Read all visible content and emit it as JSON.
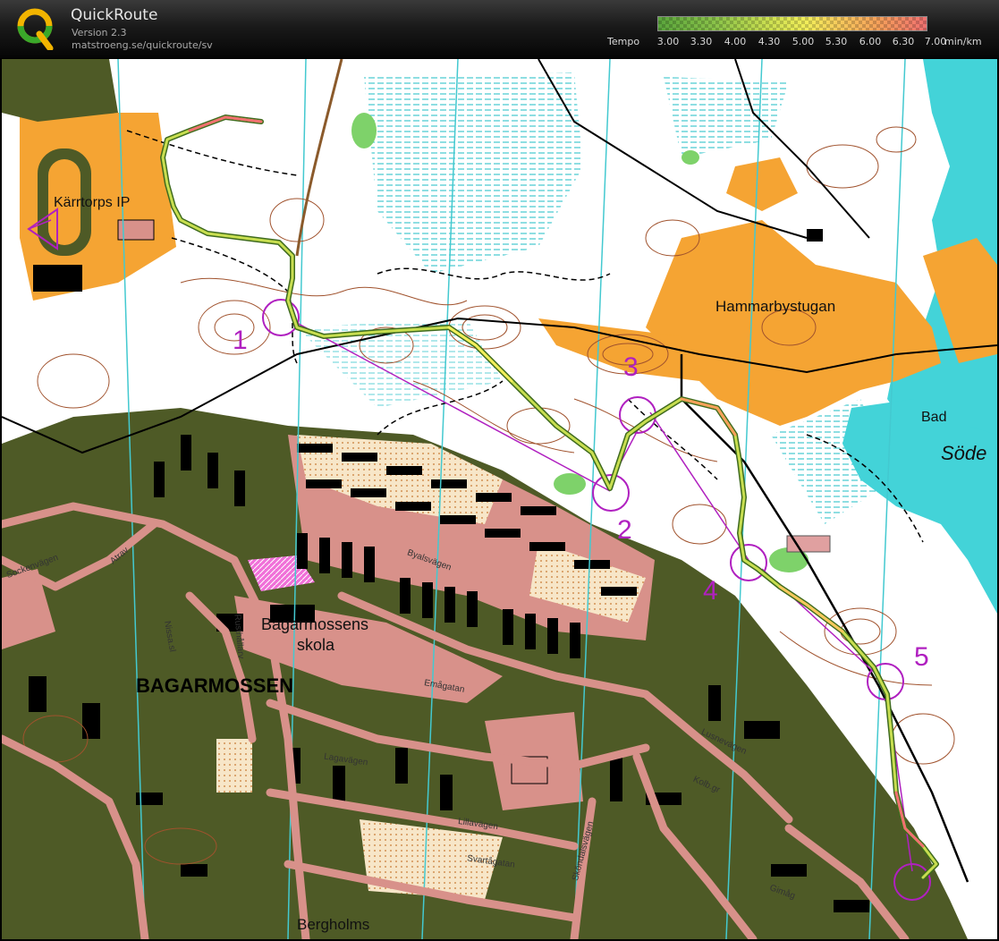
{
  "app": {
    "name": "QuickRoute",
    "version": "Version 2.3",
    "url": "matstroeng.se/quickroute/sv"
  },
  "tempo_legend": {
    "label": "Tempo",
    "ticks": [
      "3.00",
      "3.30",
      "4.00",
      "4.30",
      "5.00",
      "5.30",
      "6.00",
      "6.30",
      "7.00"
    ],
    "unit": "min/km",
    "colors": [
      "#5aa53c",
      "#8cc44a",
      "#c8de50",
      "#f2ee5a",
      "#f6c85c",
      "#f5a05a",
      "#f07070"
    ]
  },
  "map": {
    "place_names": {
      "karrtorp": "Kärrtorps IP",
      "hammarbystugan": "Hammarbystugan",
      "bad": "Bad",
      "sode": "Söde",
      "bagarmossen": "BAGARMOSSEN",
      "bagarmossens": "Bagarmossens",
      "skola": "skola",
      "bergholms": "Bergholms"
    },
    "streets": {
      "sockenvagen": "Sockenvägen",
      "byalsvagen": "Byalsvägen",
      "emagatan": "Emågatan",
      "lagavagen": "Lagavägen",
      "lillavagen": "Lillavägen",
      "svartagatan": "Svartågatan",
      "skondalsvagen": "Sköndalsvägen",
      "lusnevagen": "Lusnevägen",
      "kolb": "Kolb.gr",
      "gimag": "Gimåg",
      "rusthallarv": "Rusthållarv",
      "nissa": "Nissa.sl",
      "atrav": "Atrav"
    },
    "controls": [
      {
        "number": "1"
      },
      {
        "number": "2"
      },
      {
        "number": "3"
      },
      {
        "number": "4"
      },
      {
        "number": "5"
      }
    ],
    "colors": {
      "forest_white": "#ffffff",
      "open": "#f5a433",
      "urban": "#4e5a26",
      "water": "#43d3d8",
      "paved": "#d8918a",
      "course": "#b020c0",
      "contour": "#a0522d"
    }
  }
}
